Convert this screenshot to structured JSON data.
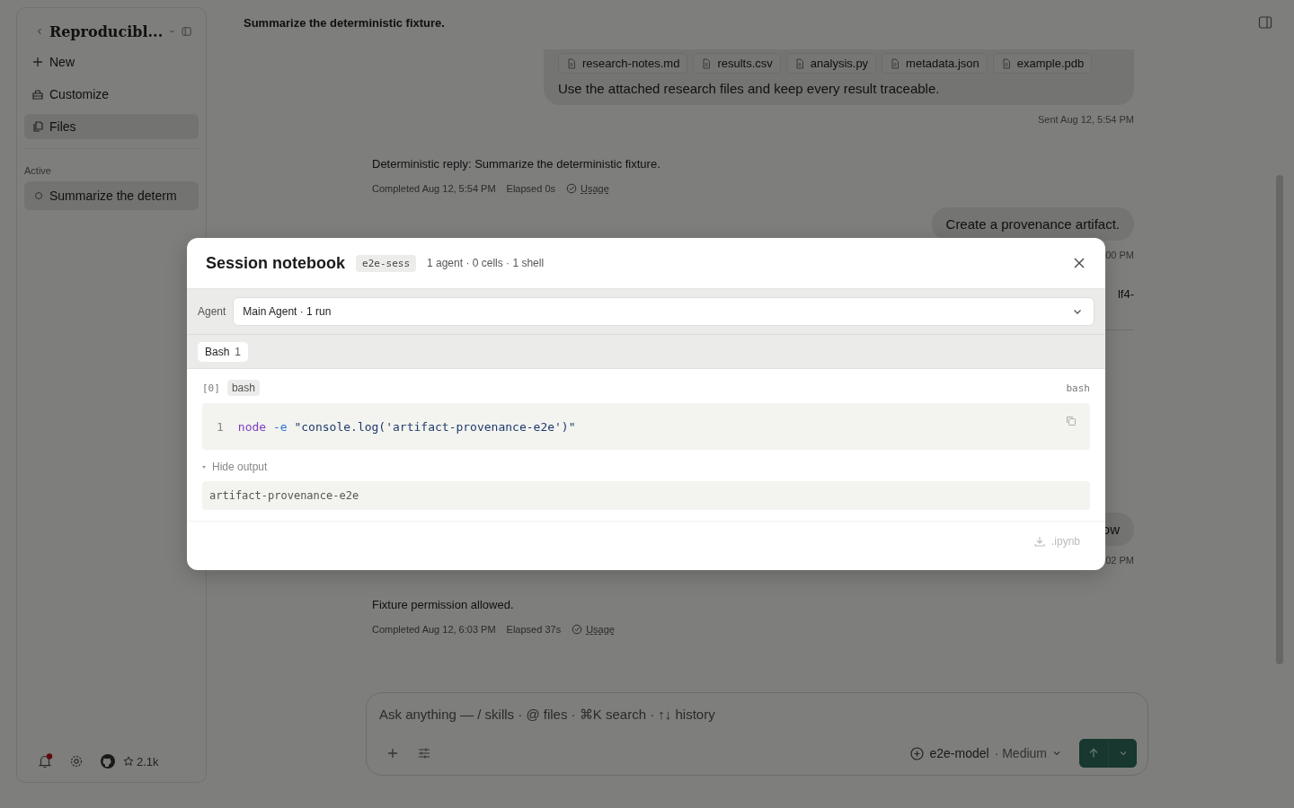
{
  "sidebar": {
    "title": "Reproducibl...",
    "nav": [
      {
        "kind": "new",
        "label": "New",
        "selected": false
      },
      {
        "kind": "customize",
        "label": "Customize",
        "selected": false
      },
      {
        "kind": "files",
        "label": "Files",
        "selected": true
      }
    ],
    "section": "Active",
    "sessions": [
      {
        "label": "Summarize the determ",
        "selected": true
      }
    ],
    "footer": {
      "notifications_unread": true,
      "stars": "2.1k"
    }
  },
  "header": {
    "title": "Summarize the deterministic fixture."
  },
  "messages": [
    {
      "kind": "user",
      "attachments": [
        "research-notes.md",
        "results.csv",
        "analysis.py",
        "metadata.json",
        "example.pdb"
      ],
      "text": "Use the attached research files and keep every result traceable.",
      "meta": "Sent Aug 12, 5:54 PM"
    },
    {
      "kind": "assistant",
      "text": "Deterministic reply: Summarize the deterministic fixture.",
      "completed": "Completed Aug 12, 5:54 PM",
      "elapsed": "Elapsed 0s",
      "usage": "Usage"
    },
    {
      "kind": "user",
      "text": "Create a provenance artifact.",
      "meta": "00 PM"
    },
    {
      "kind": "fragment",
      "text": "lf4-"
    },
    {
      "kind": "user",
      "text": "ow",
      "meta": "02 PM"
    },
    {
      "kind": "assistant",
      "text": "Fixture permission allowed.",
      "completed": "Completed Aug 12, 6:03 PM",
      "elapsed": "Elapsed 37s",
      "usage": "Usage"
    }
  ],
  "composer": {
    "placeholder": "Ask anything — / skills · @ files · ⌘K search · ↑↓ history",
    "model": "e2e-model",
    "effort": "· Medium"
  },
  "modal": {
    "title": "Session notebook",
    "badge": "e2e-sess",
    "summary": "1 agent · 0 cells · 1 shell",
    "agent_label": "Agent",
    "agent_value": "Main Agent · 1 run",
    "tabs": [
      {
        "label": "Bash",
        "count": "1",
        "selected": true
      }
    ],
    "cell": {
      "index": "[0]",
      "tag": "bash",
      "language": "bash",
      "line_number": "1",
      "code": [
        {
          "kind": "command",
          "text": "node"
        },
        {
          "kind": "flag",
          "text": "-e"
        },
        {
          "kind": "string",
          "text": "\"console.log('artifact-provenance-e2e')\""
        }
      ],
      "output_toggle": "Hide output",
      "output_expanded": true,
      "output": "artifact-provenance-e2e"
    },
    "export": {
      "label": ".ipynb",
      "disabled": true
    }
  }
}
